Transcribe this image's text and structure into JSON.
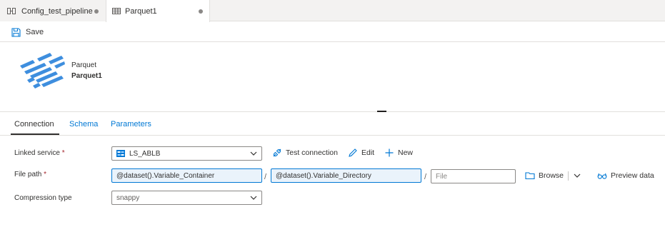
{
  "tabs": [
    {
      "label": "Config_test_pipeline",
      "icon": "pipeline-icon",
      "unsaved": true
    },
    {
      "label": "Parquet1",
      "icon": "table-icon",
      "unsaved": true,
      "active": true
    }
  ],
  "toolbar": {
    "save_label": "Save"
  },
  "dataset": {
    "type": "Parquet",
    "name": "Parquet1",
    "logo_color": "#3e8ede"
  },
  "subtabs": [
    {
      "label": "Connection",
      "active": true
    },
    {
      "label": "Schema"
    },
    {
      "label": "Parameters"
    }
  ],
  "form": {
    "linked_service": {
      "label": "Linked service",
      "required_mark": "*",
      "value": "LS_ABLB",
      "test_connection": "Test connection",
      "edit": "Edit",
      "new": "New"
    },
    "file_path": {
      "label": "File path",
      "required_mark": "*",
      "container": "@dataset().Variable_Container",
      "directory": "@dataset().Variable_Directory",
      "file_placeholder": "File",
      "separator": "/",
      "browse": "Browse",
      "preview": "Preview data"
    },
    "compression": {
      "label": "Compression type",
      "value": "snappy"
    }
  },
  "colors": {
    "accent": "#0078d4",
    "required": "#a4262c"
  }
}
